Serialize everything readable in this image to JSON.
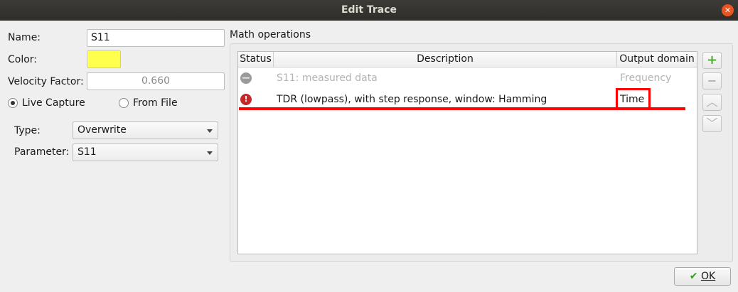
{
  "window": {
    "title": "Edit Trace",
    "close_icon": "close-icon"
  },
  "left": {
    "name_label": "Name:",
    "name_value": "S11",
    "color_label": "Color:",
    "color_value": "#ffff4d",
    "velocity_label": "Velocity Factor:",
    "velocity_value": "0.660",
    "live_capture_label": "Live Capture",
    "from_file_label": "From File",
    "source_selected": "Live Capture",
    "type_label": "Type:",
    "type_value": "Overwrite",
    "parameter_label": "Parameter:",
    "parameter_value": "S11"
  },
  "math": {
    "group_label": "Math operations",
    "columns": [
      "Status",
      "Description",
      "Output domain"
    ],
    "rows": [
      {
        "status_icon": "disabled-icon",
        "description": "S11: measured data",
        "output_domain": "Frequency",
        "enabled": false
      },
      {
        "status_icon": "error-icon",
        "description": "TDR (lowpass), with step response, window: Hamming",
        "output_domain": "Time",
        "enabled": true
      }
    ],
    "buttons": {
      "add_icon": "add-icon",
      "remove_icon": "remove-icon",
      "up_icon": "move-up-icon",
      "down_icon": "move-down-icon"
    }
  },
  "footer": {
    "ok_label": "OK",
    "ok_icon": "checkmark-icon"
  },
  "annotation": {
    "color": "#ff0000"
  }
}
